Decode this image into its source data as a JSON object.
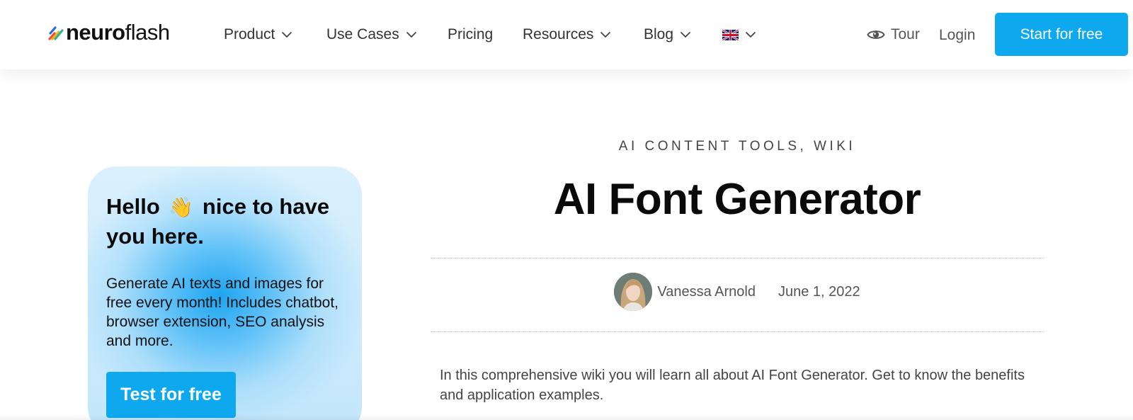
{
  "brand": {
    "logo_bold": "neuro",
    "logo_light": "flash",
    "accent_color": "#0ea8ee"
  },
  "nav": {
    "items": [
      {
        "label": "Product",
        "has_dropdown": true
      },
      {
        "label": "Use Cases",
        "has_dropdown": true
      },
      {
        "label": "Pricing",
        "has_dropdown": false
      },
      {
        "label": "Resources",
        "has_dropdown": true
      },
      {
        "label": "Blog",
        "has_dropdown": true
      }
    ],
    "language_icon": "uk-flag-icon",
    "tour_label": "Tour",
    "tour_icon": "eye-icon",
    "login_label": "Login",
    "cta_label": "Start for free"
  },
  "sidebar_card": {
    "title_before": "Hello",
    "wave_emoji": "👋",
    "title_after": "nice to have you here.",
    "text": "Generate AI texts and images for free every month! Includes chatbot, browser extension, SEO analysis and more.",
    "button_label": "Test for free"
  },
  "article": {
    "categories": "AI CONTENT TOOLS, WIKI",
    "title": "AI Font Generator",
    "author": "Vanessa Arnold",
    "date": "June 1, 2022",
    "intro": "In this comprehensive wiki you will learn all about AI Font Generator. Get to know the benefits and application examples."
  }
}
